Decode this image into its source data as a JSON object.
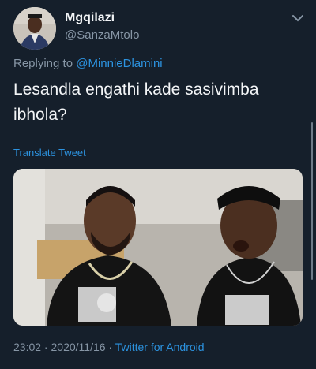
{
  "author": {
    "display_name": "Mgqilazi",
    "handle": "@SanzaMtolo"
  },
  "reply": {
    "prefix": "Replying to ",
    "mention": "@MinnieDlamini"
  },
  "tweet": {
    "text": "Lesandla engathi kade sasivimba ibhola?",
    "translate_label": "Translate Tweet"
  },
  "meta": {
    "time": "23:02",
    "date": "2020/11/16",
    "separator": " · ",
    "source": "Twitter for Android"
  },
  "colors": {
    "background": "#151f2b",
    "link": "#2c93e0",
    "muted": "#8796a6"
  },
  "icons": [
    "chevron-down-icon"
  ]
}
